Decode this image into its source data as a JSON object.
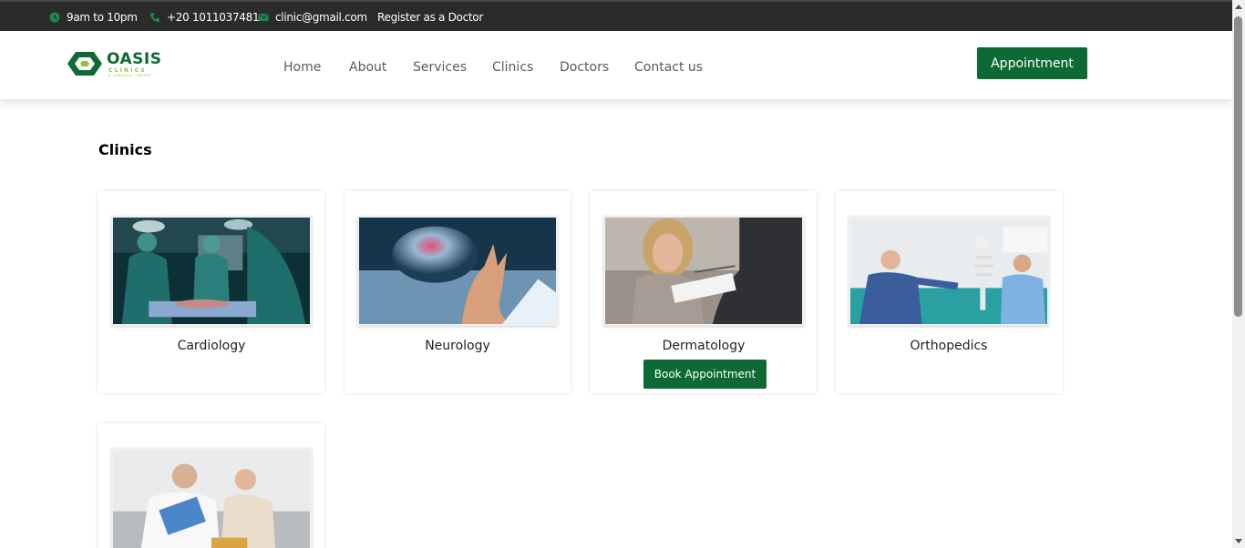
{
  "topbar": {
    "hours": "9am to 10pm",
    "phone": "+20 1011037481",
    "email": "clinic@gmail.com",
    "register": "Register as a Doctor",
    "icons": [
      "clock-icon",
      "phone-icon",
      "envelope-icon"
    ],
    "icon_color": "#1a8a4a"
  },
  "header": {
    "logo": {
      "name": "OASIS",
      "sub": "CLINICS",
      "tagline": "& SURGICAL CENTER"
    },
    "nav": [
      "Home",
      "About",
      "Services",
      "Clinics",
      "Doctors",
      "Contact us"
    ],
    "appointment_label": "Appointment"
  },
  "main": {
    "title": "Clinics",
    "clinics": [
      {
        "name": "Cardiology"
      },
      {
        "name": "Neurology"
      },
      {
        "name": "Dermatology"
      },
      {
        "name": "Orthopedics"
      },
      {
        "name": ""
      }
    ],
    "book_label": "Book Appointment"
  },
  "colors": {
    "brand_green": "#0e6a35",
    "accent_light_green": "#8bc53f",
    "topbar_bg": "#2b2b2b"
  }
}
